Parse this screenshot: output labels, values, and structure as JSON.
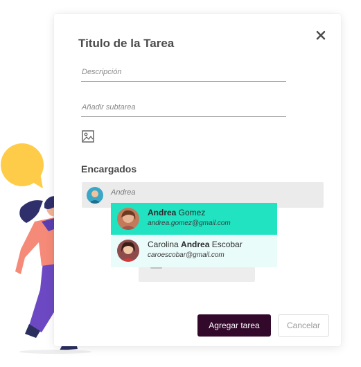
{
  "modal": {
    "title": "Titulo de la Tarea",
    "description_placeholder": "Descripción",
    "subtask_placeholder": "Añadir subtarea"
  },
  "assignees": {
    "section_label": "Encargados",
    "search_value": "Andrea",
    "options": [
      {
        "pre": "",
        "highlight": "Andrea",
        "post": " Gomez",
        "email": "andrea.gomez@gmail.com"
      },
      {
        "pre": "Carolina ",
        "highlight": "Andrea",
        "post": " Escobar",
        "email": "caroescobar@gmail.com"
      }
    ]
  },
  "actions": {
    "submit_label": "Agregar tarea",
    "cancel_label": "Cancelar"
  },
  "colors": {
    "primary_button": "#33092b",
    "selected_option": "#21e2c1",
    "speech_bubble": "#ffcc4a"
  },
  "icons": [
    "close-icon",
    "image-icon"
  ]
}
